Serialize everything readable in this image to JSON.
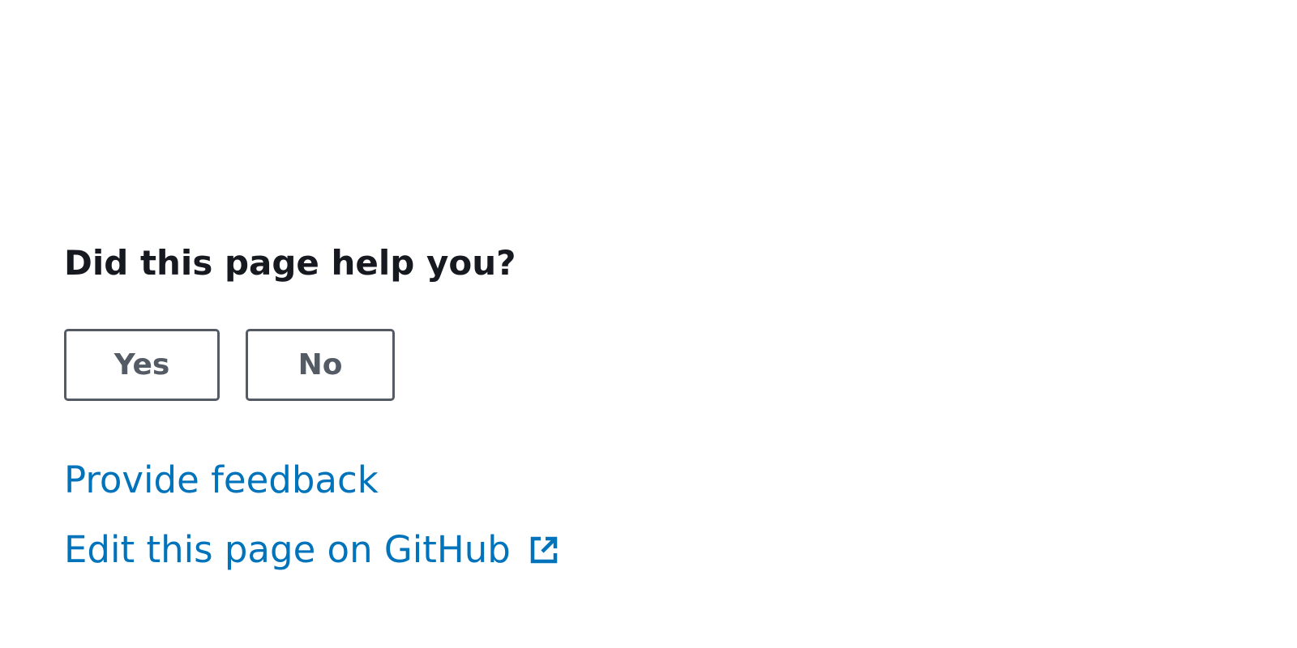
{
  "feedback": {
    "heading": "Did this page help you?",
    "yes_label": "Yes",
    "no_label": "No"
  },
  "links": {
    "provide_feedback": "Provide feedback",
    "edit_on_github": "Edit this page on GitHub",
    "external_icon": "external-link-icon"
  },
  "colors": {
    "heading": "#16191f",
    "button": "#545b64",
    "link": "#0073bb"
  }
}
